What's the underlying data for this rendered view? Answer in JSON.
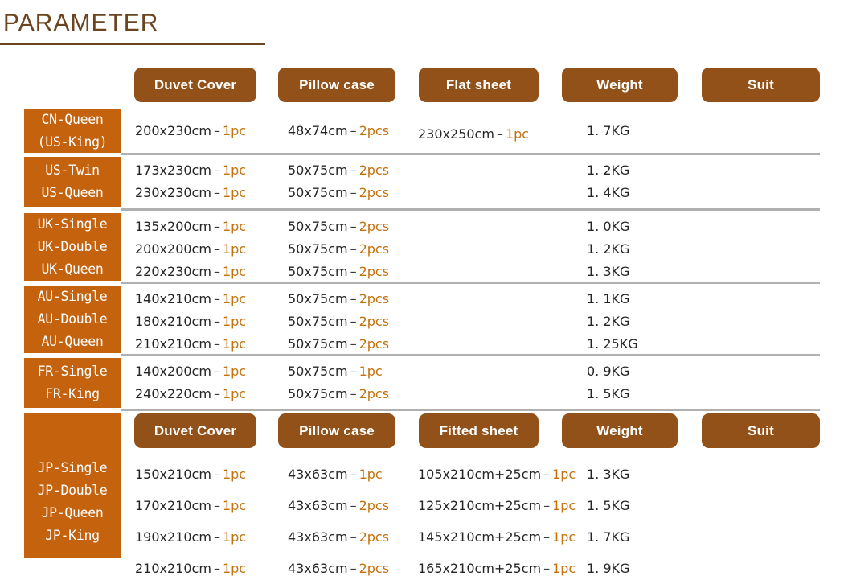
{
  "title": "PARAMETER",
  "columns": {
    "duvet": "Duvet Cover",
    "pillow": "Pillow case",
    "flat_sheet": "Flat  sheet",
    "fitted_sheet": "Fitted  sheet",
    "weight": "Weight",
    "suit": "Suit"
  },
  "colors": {
    "title": "#6b4520",
    "header_pill": "#93511a",
    "label_block": "#c4620e",
    "quantity": "#c4720e",
    "separator": "#b0b0b0",
    "text": "#262626"
  },
  "groups": [
    {
      "id": "cn",
      "labels": [
        "CN-Queen",
        "(US-King)"
      ],
      "rows": [
        {
          "duvet_size": "200x230cm",
          "duvet_dash": "–",
          "duvet_qty": "1pc",
          "pillow_size": "48x74cm",
          "pillow_dash": "–",
          "pillow_qty": "2pcs",
          "sheet_size": "230x250cm",
          "sheet_dash": "–",
          "sheet_qty": "1pc",
          "weight": "1. 7KG"
        }
      ]
    },
    {
      "id": "us",
      "labels": [
        "US-Twin",
        "US-Queen"
      ],
      "rows": [
        {
          "duvet_size": "173x230cm",
          "duvet_dash": "–",
          "duvet_qty": "1pc",
          "pillow_size": "50x75cm",
          "pillow_dash": "–",
          "pillow_qty": "2pcs",
          "sheet_size": "",
          "sheet_dash": "",
          "sheet_qty": "",
          "weight": "1. 2KG"
        },
        {
          "duvet_size": "230x230cm",
          "duvet_dash": "–",
          "duvet_qty": "1pc",
          "pillow_size": "50x75cm",
          "pillow_dash": "–",
          "pillow_qty": "2pcs",
          "sheet_size": "",
          "sheet_dash": "",
          "sheet_qty": "",
          "weight": "1. 4KG"
        }
      ]
    },
    {
      "id": "uk",
      "labels": [
        "UK-Single",
        "UK-Double",
        "UK-Queen"
      ],
      "rows": [
        {
          "duvet_size": "135x200cm",
          "duvet_dash": "–",
          "duvet_qty": "1pc",
          "pillow_size": "50x75cm",
          "pillow_dash": "–",
          "pillow_qty": "2pcs",
          "sheet_size": "",
          "sheet_dash": "",
          "sheet_qty": "",
          "weight": "1. 0KG"
        },
        {
          "duvet_size": "200x200cm",
          "duvet_dash": "–",
          "duvet_qty": "1pc",
          "pillow_size": "50x75cm",
          "pillow_dash": "–",
          "pillow_qty": "2pcs",
          "sheet_size": "",
          "sheet_dash": "",
          "sheet_qty": "",
          "weight": "1. 2KG"
        },
        {
          "duvet_size": "220x230cm",
          "duvet_dash": "–",
          "duvet_qty": "1pc",
          "pillow_size": "50x75cm",
          "pillow_dash": "–",
          "pillow_qty": "2pcs",
          "sheet_size": "",
          "sheet_dash": "",
          "sheet_qty": "",
          "weight": "1. 3KG"
        }
      ]
    },
    {
      "id": "au",
      "labels": [
        "AU-Single",
        "AU-Double",
        "AU-Queen"
      ],
      "rows": [
        {
          "duvet_size": "140x210cm",
          "duvet_dash": "–",
          "duvet_qty": "1pc",
          "pillow_size": "50x75cm",
          "pillow_dash": "–",
          "pillow_qty": "2pcs",
          "sheet_size": "",
          "sheet_dash": "",
          "sheet_qty": "",
          "weight": "1. 1KG"
        },
        {
          "duvet_size": "180x210cm",
          "duvet_dash": "–",
          "duvet_qty": "1pc",
          "pillow_size": "50x75cm",
          "pillow_dash": "–",
          "pillow_qty": "2pcs",
          "sheet_size": "",
          "sheet_dash": "",
          "sheet_qty": "",
          "weight": "1. 2KG"
        },
        {
          "duvet_size": "210x210cm",
          "duvet_dash": "–",
          "duvet_qty": "1pc",
          "pillow_size": "50x75cm",
          "pillow_dash": "–",
          "pillow_qty": "2pcs",
          "sheet_size": "",
          "sheet_dash": "",
          "sheet_qty": "",
          "weight": "1. 25KG"
        }
      ]
    },
    {
      "id": "fr",
      "labels": [
        "FR-Single",
        "FR-King"
      ],
      "rows": [
        {
          "duvet_size": "140x200cm",
          "duvet_dash": "–",
          "duvet_qty": "1pc",
          "pillow_size": "50x75cm",
          "pillow_dash": "–",
          "pillow_qty": "1pc",
          "sheet_size": "",
          "sheet_dash": "",
          "sheet_qty": "",
          "weight": "0. 9KG"
        },
        {
          "duvet_size": "240x220cm",
          "duvet_dash": "–",
          "duvet_qty": "1pc",
          "pillow_size": "50x75cm",
          "pillow_dash": "–",
          "pillow_qty": "2pcs",
          "sheet_size": "",
          "sheet_dash": "",
          "sheet_qty": "",
          "weight": "1. 5KG"
        }
      ]
    },
    {
      "id": "jp",
      "labels": [
        "JP-Single",
        "JP-Double",
        "JP-Queen",
        "JP-King"
      ],
      "rows": [
        {
          "duvet_size": "150x210cm",
          "duvet_dash": "–",
          "duvet_qty": "1pc",
          "pillow_size": "43x63cm",
          "pillow_dash": "–",
          "pillow_qty": "1pc",
          "sheet_size": "105x210cm+25cm",
          "sheet_dash": "–",
          "sheet_qty": "1pc",
          "weight": "1. 3KG"
        },
        {
          "duvet_size": "170x210cm",
          "duvet_dash": "–",
          "duvet_qty": "1pc",
          "pillow_size": "43x63cm",
          "pillow_dash": "–",
          "pillow_qty": "2pcs",
          "sheet_size": "125x210cm+25cm",
          "sheet_dash": "–",
          "sheet_qty": "1pc",
          "weight": "1. 5KG"
        },
        {
          "duvet_size": "190x210cm",
          "duvet_dash": "–",
          "duvet_qty": "1pc",
          "pillow_size": "43x63cm",
          "pillow_dash": "–",
          "pillow_qty": "2pcs",
          "sheet_size": "145x210cm+25cm",
          "sheet_dash": "–",
          "sheet_qty": "1pc",
          "weight": "1. 7KG"
        },
        {
          "duvet_size": "210x210cm",
          "duvet_dash": "–",
          "duvet_qty": "1pc",
          "pillow_size": "43x63cm",
          "pillow_dash": "–",
          "pillow_qty": "2pcs",
          "sheet_size": "165x210cm+25cm",
          "sheet_dash": "–",
          "sheet_qty": "1pc",
          "weight": "1. 9KG"
        }
      ]
    }
  ]
}
